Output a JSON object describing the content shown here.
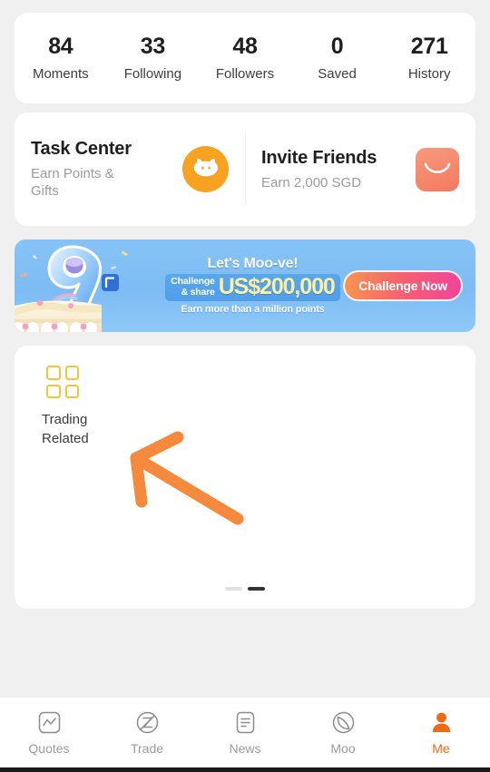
{
  "stats": [
    {
      "value": "84",
      "label": "Moments"
    },
    {
      "value": "33",
      "label": "Following"
    },
    {
      "value": "48",
      "label": "Followers"
    },
    {
      "value": "0",
      "label": "Saved"
    },
    {
      "value": "271",
      "label": "History"
    }
  ],
  "entries": [
    {
      "title": "Task Center",
      "subtitle": "Earn Points & Gifts",
      "icon": "bull-face-icon"
    },
    {
      "title": "Invite Friends",
      "subtitle": "Earn 2,000 SGD",
      "icon": "envelope-icon"
    }
  ],
  "banner": {
    "headline": "Let's Moo-ve!",
    "challenge_line1": "Challenge",
    "challenge_line2": "& share",
    "amount": "US$200,000",
    "subline": "Earn more than a million points",
    "cta_label": "Challenge Now",
    "art_numeral": "9",
    "art_icon": "anniversary-cake-icon",
    "colors": {
      "background": "#7dbcf4",
      "amount_text": "#fbf0a6",
      "cta_gradient_start": "#f9954f",
      "cta_gradient_end": "#f1439c"
    }
  },
  "shortcuts": {
    "items": [
      {
        "label": "Trading\nRelated",
        "icon": "grid-four-squares-icon",
        "icon_color": "#f3c53c"
      }
    ],
    "pager": {
      "total": 2,
      "active_index": 1
    }
  },
  "annotation": {
    "type": "hand-drawn-arrow",
    "color": "#f58a3c",
    "points_to": "grid-four-squares-icon"
  },
  "tabbar": {
    "active": "Me",
    "active_color": "#f4690f",
    "items": [
      {
        "label": "Quotes",
        "icon": "chart-square-icon",
        "active": false
      },
      {
        "label": "Trade",
        "icon": "trade-circle-z-icon",
        "active": false
      },
      {
        "label": "News",
        "icon": "document-lines-icon",
        "active": false
      },
      {
        "label": "Moo",
        "icon": "moo-crescent-icon",
        "active": false
      },
      {
        "label": "Me",
        "icon": "person-icon",
        "active": true
      }
    ]
  }
}
